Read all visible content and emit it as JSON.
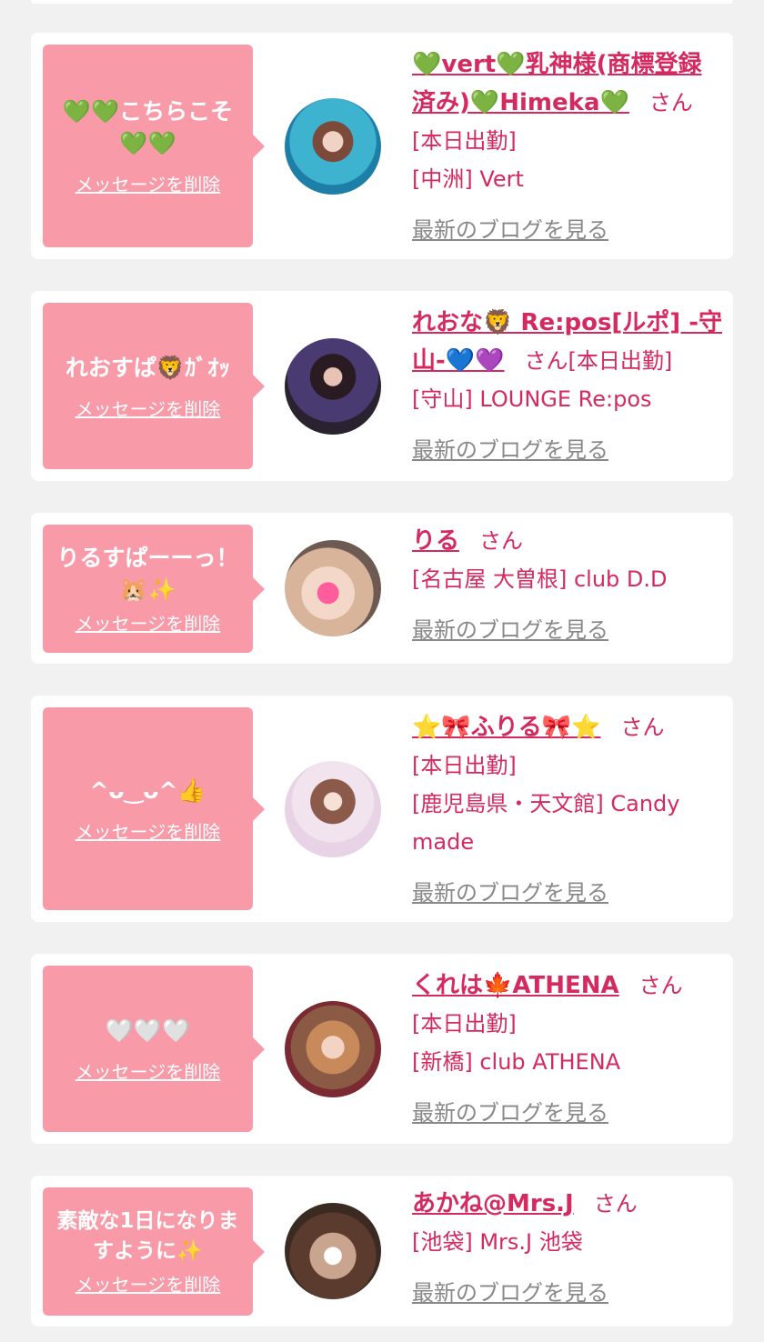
{
  "delete_label": "メッセージを削除",
  "blog_label": "最新のブログを見る",
  "san_label": "さん",
  "cards": [
    {
      "message": "💚💚こちらこそ💚💚",
      "name": "💚vert💚乳神様(商標登録済み)💚Himeka💚",
      "lines": [
        "[本日出勤]",
        "[中洲] Vert"
      ]
    },
    {
      "message": "れおすぱ🦁ｶﾞｵｯ",
      "name": "れおな🦁 Re:pos[ルポ] -守山-💙💜",
      "lines": [
        "[本日出勤]",
        "[守山] LOUNGE Re:pos"
      ]
    },
    {
      "message": "りるすぱーーっ！🐹✨",
      "name": "りる",
      "lines": [
        "[名古屋 大曽根] club D.D"
      ]
    },
    {
      "message": "^ᴗ‿ᴗ^👍",
      "name": "⭐🎀ふりる🎀⭐",
      "lines": [
        "[本日出勤]",
        "[鹿児島県・天文館] Candy made"
      ]
    },
    {
      "message": "🤍🤍🤍",
      "name": "くれは🍁ATHENA",
      "lines": [
        "[本日出勤]",
        "[新橋] club ATHENA"
      ]
    },
    {
      "message": "素敵な1日になりますように✨",
      "name": "あかね@Mrs.J",
      "lines": [
        "[池袋] Mrs.J 池袋"
      ]
    }
  ]
}
